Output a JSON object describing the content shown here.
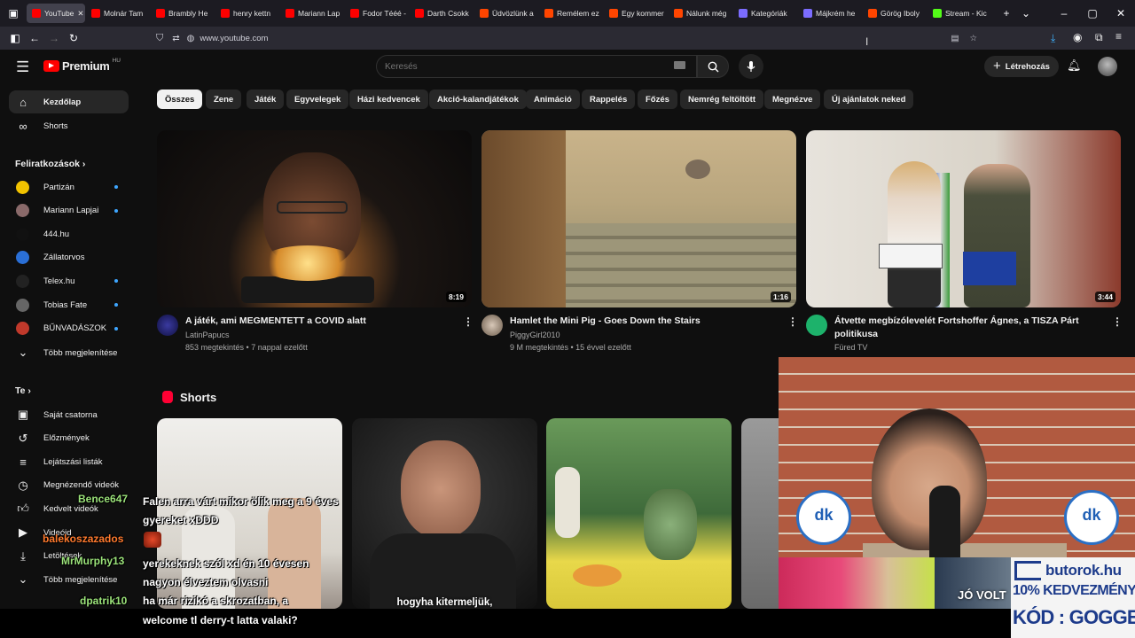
{
  "browser": {
    "tabs": [
      {
        "label": "YouTube",
        "active": true,
        "color": "#ff0000"
      },
      {
        "label": "Molnár Tam",
        "color": "#ff0000"
      },
      {
        "label": "Brambly He",
        "color": "#ff0000"
      },
      {
        "label": "henry kettn",
        "color": "#ff0000"
      },
      {
        "label": "Mariann Lap",
        "color": "#ff0000"
      },
      {
        "label": "Fodor Tééé -",
        "color": "#ff0000"
      },
      {
        "label": "Darth Csokk",
        "color": "#ff0000"
      },
      {
        "label": "Üdvözlünk a",
        "color": "#ff4500"
      },
      {
        "label": "Remélem ez",
        "color": "#ff4500"
      },
      {
        "label": "Egy kommer",
        "color": "#ff4500"
      },
      {
        "label": "Nálunk még",
        "color": "#ff4500"
      },
      {
        "label": "Kategóriák",
        "color": "#7b6cff"
      },
      {
        "label": "Májkrém he",
        "color": "#7b6cff"
      },
      {
        "label": "Görög Iboly",
        "color": "#ff4500"
      },
      {
        "label": "Stream - Kic",
        "color": "#53fc18"
      }
    ],
    "url": "www.youtube.com"
  },
  "youtube": {
    "logo": "Premium",
    "logo_region": "HU",
    "search_placeholder": "Keresés",
    "create_label": "Létrehozás",
    "sidebar": {
      "main": [
        {
          "label": "Kezdőlap",
          "icon": "home-icon",
          "selected": true
        },
        {
          "label": "Shorts",
          "icon": "shorts-icon"
        }
      ],
      "subs_title": "Feliratkozások",
      "subs": [
        {
          "label": "Partizán",
          "color": "#f2c300",
          "new": true
        },
        {
          "label": "Mariann Lapjai",
          "color": "#8a6a6a",
          "new": true
        },
        {
          "label": "444.hu",
          "color": "#111",
          "new": false
        },
        {
          "label": "Zállatorvos",
          "color": "#2a6fd6",
          "new": false
        },
        {
          "label": "Telex.hu",
          "color": "#222",
          "new": true
        },
        {
          "label": "Tobias Fate",
          "color": "#666",
          "new": true
        },
        {
          "label": "BŰNVADÁSZOK",
          "color": "#c0392b",
          "new": true
        }
      ],
      "more_subs": "Több megjelenítése",
      "you_title": "Te",
      "you": [
        {
          "label": "Saját csatorna",
          "icon": "channel-icon"
        },
        {
          "label": "Előzmények",
          "icon": "history-icon"
        },
        {
          "label": "Lejátszási listák",
          "icon": "playlist-icon"
        },
        {
          "label": "Megnézendő videók",
          "icon": "clock-icon"
        },
        {
          "label": "Kedvelt videók",
          "icon": "like-icon"
        },
        {
          "label": "Videóid",
          "icon": "video-icon"
        },
        {
          "label": "Letöltések",
          "icon": "download-icon"
        }
      ],
      "more_you": "Több megjelenítése"
    },
    "chips": [
      "Összes",
      "Zene",
      "Játék",
      "Egyvelegek",
      "Házi kedvencek",
      "Akció-kalandjátékok",
      "Animáció",
      "Rappelés",
      "Főzés",
      "Nemrég feltöltött",
      "Megnézve",
      "Új ajánlatok neked"
    ],
    "videos": [
      {
        "title": "A játék, ami MEGMENTETT a COVID alatt",
        "channel": "LatinPapucs",
        "meta": "853 megtekintés • 7 nappal ezelőtt",
        "duration": "8:19"
      },
      {
        "title": "Hamlet the Mini Pig - Goes Down the Stairs",
        "channel": "PiggyGirl2010",
        "meta": "9 M megtekintés • 15 évvel ezelőtt",
        "duration": "1:16"
      },
      {
        "title": "Átvette megbízólevelét Fortshoffer Ágnes, a TISZA Párt politikusa",
        "channel": "Füred TV",
        "meta": "",
        "duration": "3:44"
      }
    ],
    "shorts_title": "Shorts",
    "shorts_captions": [
      "",
      "hogyha kitermeljük,",
      "",
      ""
    ]
  },
  "overlay": {
    "chat": [
      {
        "user": "Bence647",
        "user_color": "#9be37a",
        "text": "Falen arra várt mikor ölik meg a 9 éves gyereket xDDD"
      },
      {
        "user": "balekoszazados",
        "user_color": "#ff7a2e",
        "text": ""
      },
      {
        "user": "MrMurphy13",
        "user_color": "#9be37a",
        "text": "yerekeknek szól xd én 10 évesen nagyon élveztem olvasni"
      },
      {
        "user": "dpatrik10",
        "user_color": "#9be37a",
        "text": "ha már rizikó a skrozatban, a"
      },
      {
        "user": "",
        "user_color": "#ffffff",
        "text": "welcome tl derry-t latta valaki?"
      }
    ],
    "ad": {
      "brand": "butorok.hu",
      "line1": "10% KEDVEZMÉNY",
      "line2": "KÓD : GOGGER"
    },
    "webcam_sign": "dk",
    "webcam_caption": "JÓ VOLT"
  }
}
